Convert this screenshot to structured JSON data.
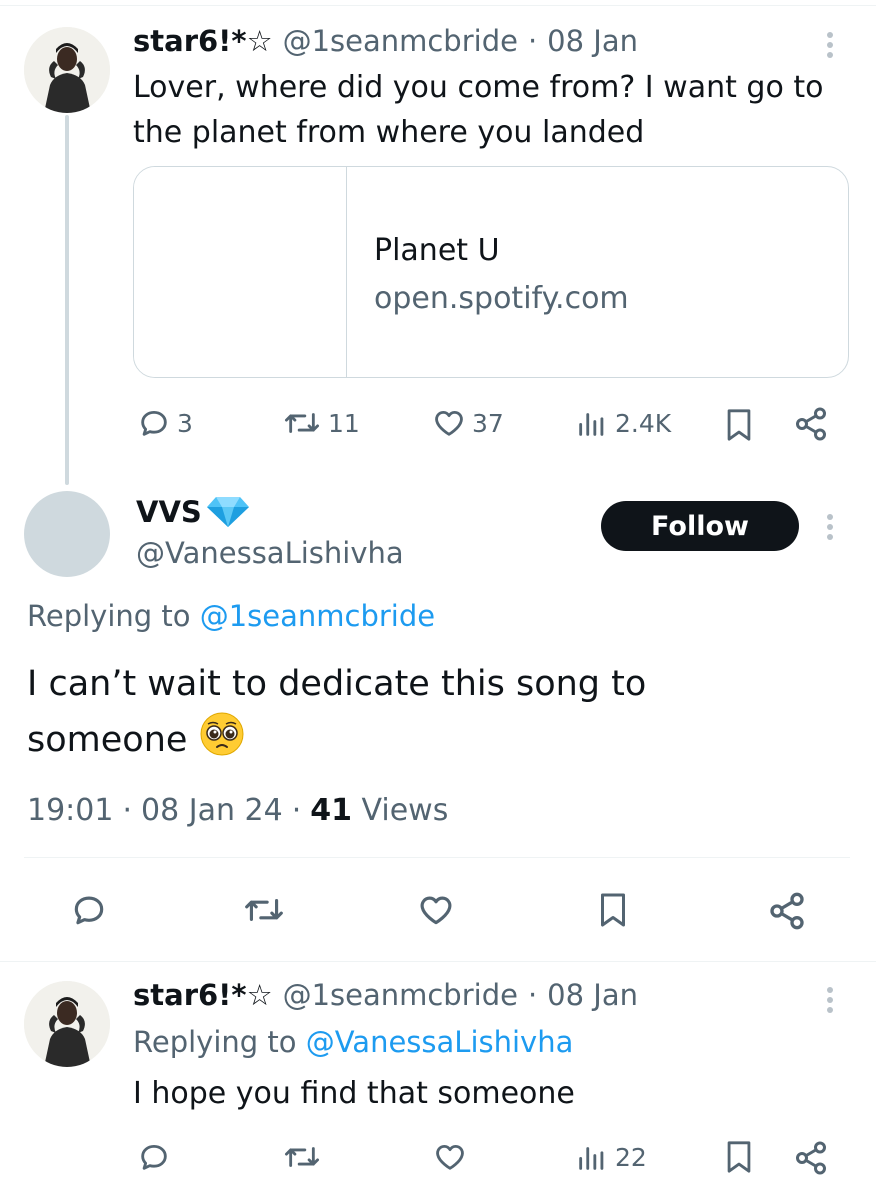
{
  "tweet1": {
    "display_name": "star6!*☆",
    "handle": "@1seanmcbride",
    "separator": "·",
    "date": "08 Jan",
    "text": "Lover, where did you come from? I want go to the planet from where you landed",
    "card": {
      "title": "Planet U",
      "domain": "open.spotify.com"
    },
    "actions": {
      "replies": "3",
      "retweets": "11",
      "likes": "37",
      "views": "2.4K"
    }
  },
  "main_tweet": {
    "display_name": "VVS",
    "badge_icon": "gem-icon",
    "handle": "@VanessaLishivha",
    "follow_label": "Follow",
    "replying_prefix": "Replying to",
    "replying_handle": "@1seanmcbride",
    "text": "I can’t wait to dedicate this song to someone",
    "emoji": "🥺",
    "time": "19:01",
    "date": "08 Jan 24",
    "views_count": "41",
    "views_label": "Views",
    "separator": "·"
  },
  "reply": {
    "display_name": "star6!*☆",
    "handle": "@1seanmcbride",
    "separator": "·",
    "date": "08 Jan",
    "replying_prefix": "Replying to",
    "replying_handle": "@VanessaLishivha",
    "text": "I hope you find that someone",
    "actions": {
      "views": "22"
    }
  },
  "colors": {
    "text_primary": "#0f1419",
    "text_secondary": "#536471",
    "link": "#1d9bf0",
    "border": "#cfd9de",
    "follow_bg": "#0f1419"
  }
}
